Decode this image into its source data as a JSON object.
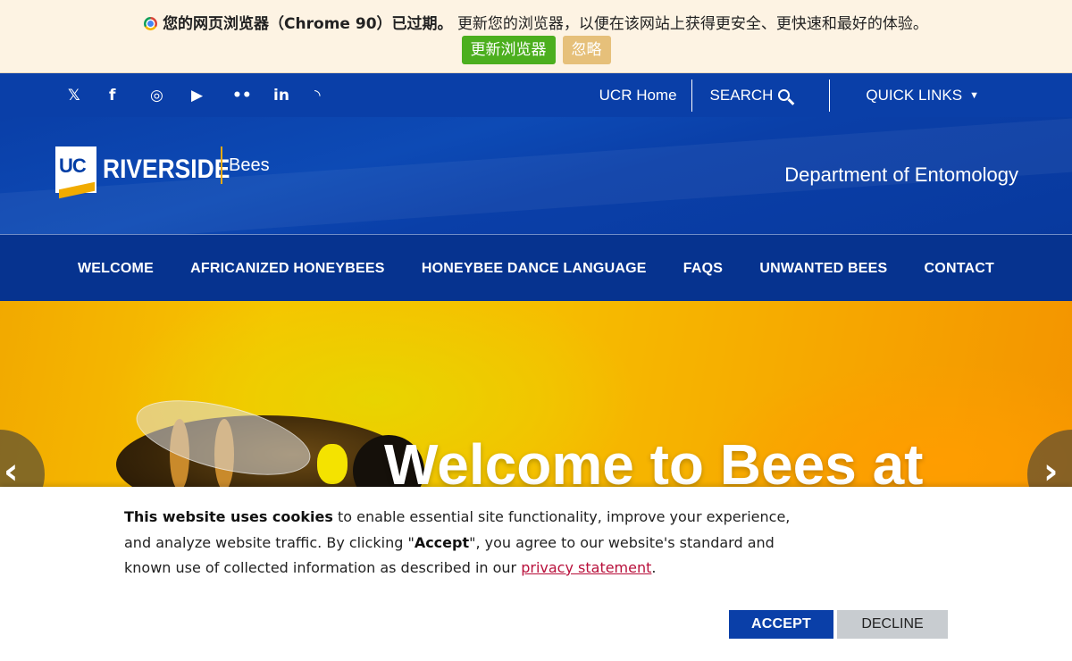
{
  "browser_warning": {
    "title": "您的网页浏览器（Chrome 90）已过期。",
    "message": "更新您的浏览器，以便在该网站上获得更安全、更快速和最好的体验。",
    "update_label": "更新浏览器",
    "ignore_label": "忽略"
  },
  "utility": {
    "social_icons": [
      "x-icon",
      "facebook-icon",
      "instagram-icon",
      "youtube-icon",
      "flickr-icon",
      "linkedin-icon",
      "rss-icon"
    ],
    "ucr_home": "UCR Home",
    "search": "SEARCH",
    "quick_links": "QUICK LINKS"
  },
  "header": {
    "logo_uc": "UC",
    "logo_riverside": "RIVERSIDE",
    "site_name": "Bees",
    "department": "Department of Entomology"
  },
  "nav": {
    "items": [
      "WELCOME",
      "AFRICANIZED HONEYBEES",
      "HONEYBEE DANCE LANGUAGE",
      "FAQS",
      "UNWANTED BEES",
      "CONTACT"
    ]
  },
  "hero": {
    "title": "Welcome to Bees at"
  },
  "cookie": {
    "lead": "This website uses cookies",
    "text1": " to enable essential site functionality, improve your experience, and analyze website traffic. By clicking \"",
    "accept_word": "Accept",
    "text2": "\", you agree to our website's standard and known use of collected information as described in our ",
    "link": "privacy statement",
    "end": ".",
    "accept_label": "ACCEPT",
    "decline_label": "DECLINE"
  },
  "colors": {
    "ucr_blue": "#0a3fa8",
    "ucr_gold": "#f1ab00",
    "update_green": "#4caf1e",
    "link_red": "#b8103b"
  }
}
